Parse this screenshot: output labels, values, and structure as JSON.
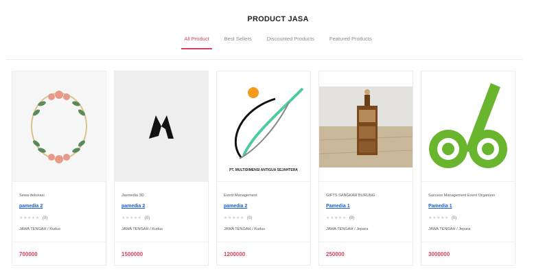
{
  "section": {
    "title": "PRODUCT JASA"
  },
  "tabs": [
    {
      "label": "All Product",
      "active": true
    },
    {
      "label": "Best Sellers",
      "active": false
    },
    {
      "label": "Discounted Products",
      "active": false
    },
    {
      "label": "Featured Products",
      "active": false
    }
  ],
  "products": [
    {
      "name": "Sewa dekorasi",
      "vendor": "pamedia 2",
      "rating_count": "(0)",
      "location": "JAWA TENGAH / Kudus",
      "price": "700000"
    },
    {
      "name": "Jasmedia 3D",
      "vendor": "pamedia 2",
      "rating_count": "(0)",
      "location": "JAWA TENGAH / Kudus",
      "price": "1500000"
    },
    {
      "name": "Event Management",
      "vendor": "pamedia 2",
      "rating_count": "(0)",
      "location": "JAWA TENGAH / Kudus",
      "price": "1200000"
    },
    {
      "name": "GIFTS SANGKAR BURUNG",
      "vendor": "Pamedia 1",
      "rating_count": "(0)",
      "location": "JAWA TENGAH / Jepara",
      "price": "250000"
    },
    {
      "name": "Success Management Event Organizer",
      "vendor": "Pamedia 1",
      "rating_count": "(0)",
      "location": "JAWA TENGAH / Jepara",
      "price": "3000000"
    }
  ],
  "stars": "★★★★★",
  "colors": {
    "accent": "#d9415a",
    "link": "#1a5dd6",
    "logo_green": "#6ab52e"
  },
  "icons": {
    "p1": "floral-wreath-image",
    "p2": "m-logo-image",
    "p3": "company-logo-image",
    "p4": "bird-cage-photo",
    "p5": "green-check-logo-image"
  },
  "image_text": {
    "p3_caption": "PT. MULTIDIMENSI ANTIGUA SEJAHTERA"
  }
}
